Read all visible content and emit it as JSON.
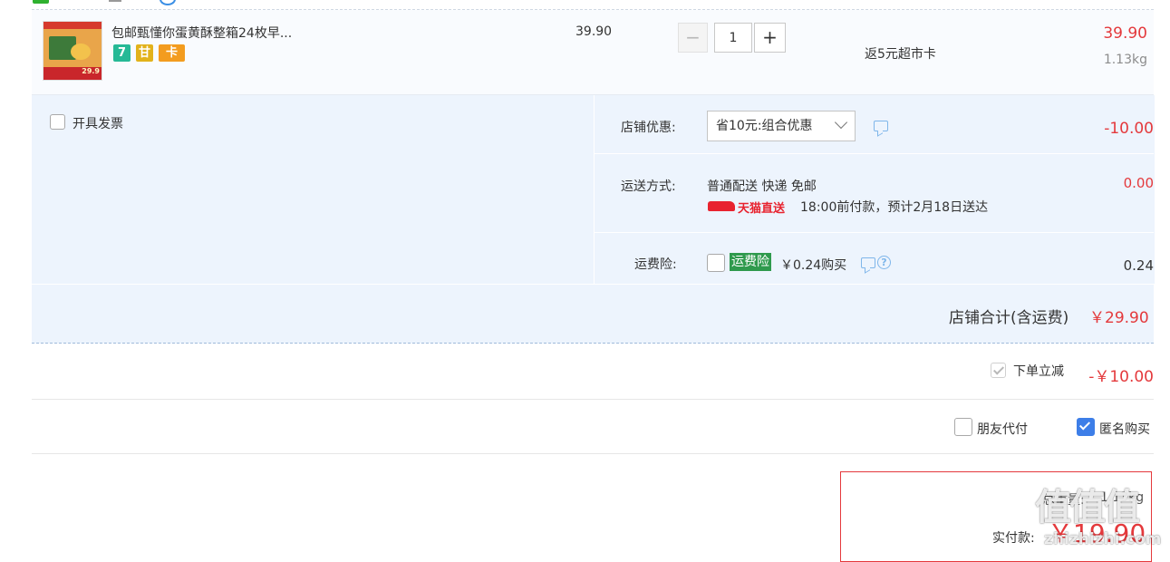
{
  "product": {
    "title": "包邮甄懂你蛋黄酥整箱24枚早...",
    "thumb_price": "29.9",
    "badges": [
      "7",
      "甘",
      "卡"
    ],
    "unit_price": "39.90",
    "qty_minus": "−",
    "quantity": "1",
    "qty_plus": "+",
    "rebate": "返5元超市卡",
    "total": "39.90",
    "weight": "1.13kg"
  },
  "invoice": {
    "label": "开具发票",
    "checked": false
  },
  "shop_discount": {
    "label": "店铺优惠:",
    "selected": "省10元:组合优惠",
    "amount": "-10.00"
  },
  "shipping": {
    "label": "运送方式:",
    "method": "普通配送 快递 免邮",
    "tmall_logo_text": "天猫直送",
    "eta": "18:00前付款，预计2月18日送达",
    "amount": "0.00"
  },
  "insurance": {
    "label": "运费险:",
    "tag": "运费险",
    "price": "￥0.24购买",
    "help_icon": "?",
    "amount": "0.24",
    "checked": false
  },
  "shop_total": {
    "label": "店铺合计(含运费)",
    "value": "￥29.90"
  },
  "instant_discount": {
    "label": "下单立减",
    "value": "-￥10.00",
    "checked": true
  },
  "options": {
    "friend_pay": {
      "label": "朋友代付",
      "checked": false
    },
    "anonymous": {
      "label": "匿名购买",
      "checked": true
    }
  },
  "summary": {
    "weight_label": "总重量:",
    "weight_value": "1.13kg",
    "pay_label": "实付款:",
    "pay_value": "￥19.90"
  },
  "watermark": {
    "chars": "值值值",
    "site": "zhizhizhi.com"
  },
  "colors": {
    "accent_red": "#e4393c",
    "panel_blue": "#edf4fd",
    "check_blue": "#3d7ee8",
    "tag_green": "#2f9a4d"
  }
}
